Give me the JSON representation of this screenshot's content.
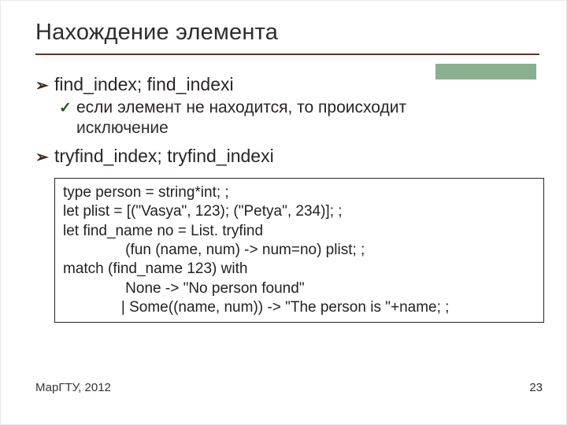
{
  "title": "Нахождение элемента",
  "bullets": {
    "b1a": "find_index; find_indexi",
    "b1a_sub1": "если элемент не находится, то происходит",
    "b1a_sub1_cont": "исключение",
    "b1b": "tryfind_index; tryfind_indexi"
  },
  "code": {
    "l1": "type person = string*int; ;",
    "l2": "let plist = [(\"Vasya\", 123); (\"Petya\", 234)]; ;",
    "l3": "let find_name no = List. tryfind",
    "l4": "               (fun (name, num) -> num=no) plist; ;",
    "l5": "match (find_name 123) with",
    "l6": "               None -> \"No person found\"",
    "l7": "              | Some((name, num)) -> \"The person is \"+name; ;"
  },
  "footer": {
    "org": "МарГТУ, 2012",
    "page": "23"
  }
}
